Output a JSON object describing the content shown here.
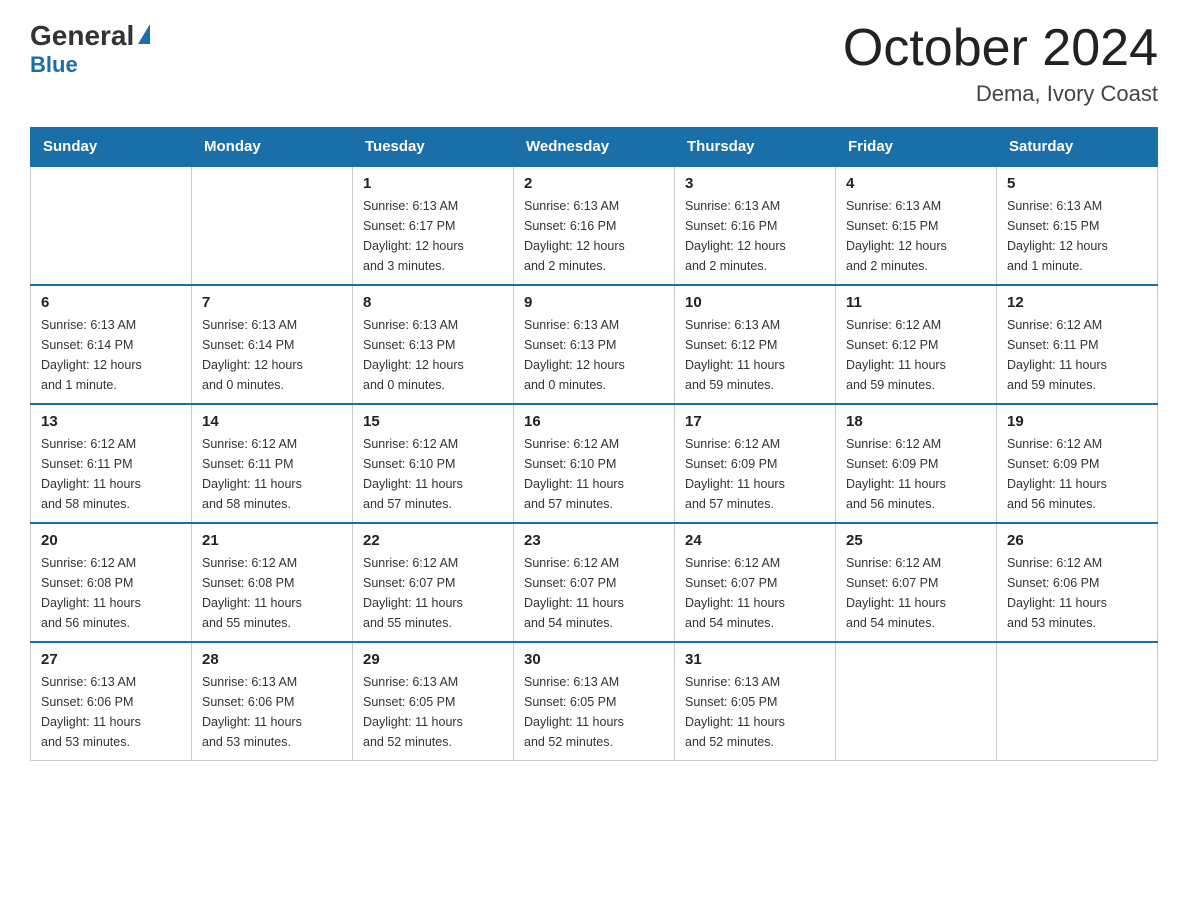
{
  "logo": {
    "general": "General",
    "blue": "Blue"
  },
  "title": "October 2024",
  "location": "Dema, Ivory Coast",
  "days_header": [
    "Sunday",
    "Monday",
    "Tuesday",
    "Wednesday",
    "Thursday",
    "Friday",
    "Saturday"
  ],
  "weeks": [
    [
      {
        "day": "",
        "info": ""
      },
      {
        "day": "",
        "info": ""
      },
      {
        "day": "1",
        "info": "Sunrise: 6:13 AM\nSunset: 6:17 PM\nDaylight: 12 hours\nand 3 minutes."
      },
      {
        "day": "2",
        "info": "Sunrise: 6:13 AM\nSunset: 6:16 PM\nDaylight: 12 hours\nand 2 minutes."
      },
      {
        "day": "3",
        "info": "Sunrise: 6:13 AM\nSunset: 6:16 PM\nDaylight: 12 hours\nand 2 minutes."
      },
      {
        "day": "4",
        "info": "Sunrise: 6:13 AM\nSunset: 6:15 PM\nDaylight: 12 hours\nand 2 minutes."
      },
      {
        "day": "5",
        "info": "Sunrise: 6:13 AM\nSunset: 6:15 PM\nDaylight: 12 hours\nand 1 minute."
      }
    ],
    [
      {
        "day": "6",
        "info": "Sunrise: 6:13 AM\nSunset: 6:14 PM\nDaylight: 12 hours\nand 1 minute."
      },
      {
        "day": "7",
        "info": "Sunrise: 6:13 AM\nSunset: 6:14 PM\nDaylight: 12 hours\nand 0 minutes."
      },
      {
        "day": "8",
        "info": "Sunrise: 6:13 AM\nSunset: 6:13 PM\nDaylight: 12 hours\nand 0 minutes."
      },
      {
        "day": "9",
        "info": "Sunrise: 6:13 AM\nSunset: 6:13 PM\nDaylight: 12 hours\nand 0 minutes."
      },
      {
        "day": "10",
        "info": "Sunrise: 6:13 AM\nSunset: 6:12 PM\nDaylight: 11 hours\nand 59 minutes."
      },
      {
        "day": "11",
        "info": "Sunrise: 6:12 AM\nSunset: 6:12 PM\nDaylight: 11 hours\nand 59 minutes."
      },
      {
        "day": "12",
        "info": "Sunrise: 6:12 AM\nSunset: 6:11 PM\nDaylight: 11 hours\nand 59 minutes."
      }
    ],
    [
      {
        "day": "13",
        "info": "Sunrise: 6:12 AM\nSunset: 6:11 PM\nDaylight: 11 hours\nand 58 minutes."
      },
      {
        "day": "14",
        "info": "Sunrise: 6:12 AM\nSunset: 6:11 PM\nDaylight: 11 hours\nand 58 minutes."
      },
      {
        "day": "15",
        "info": "Sunrise: 6:12 AM\nSunset: 6:10 PM\nDaylight: 11 hours\nand 57 minutes."
      },
      {
        "day": "16",
        "info": "Sunrise: 6:12 AM\nSunset: 6:10 PM\nDaylight: 11 hours\nand 57 minutes."
      },
      {
        "day": "17",
        "info": "Sunrise: 6:12 AM\nSunset: 6:09 PM\nDaylight: 11 hours\nand 57 minutes."
      },
      {
        "day": "18",
        "info": "Sunrise: 6:12 AM\nSunset: 6:09 PM\nDaylight: 11 hours\nand 56 minutes."
      },
      {
        "day": "19",
        "info": "Sunrise: 6:12 AM\nSunset: 6:09 PM\nDaylight: 11 hours\nand 56 minutes."
      }
    ],
    [
      {
        "day": "20",
        "info": "Sunrise: 6:12 AM\nSunset: 6:08 PM\nDaylight: 11 hours\nand 56 minutes."
      },
      {
        "day": "21",
        "info": "Sunrise: 6:12 AM\nSunset: 6:08 PM\nDaylight: 11 hours\nand 55 minutes."
      },
      {
        "day": "22",
        "info": "Sunrise: 6:12 AM\nSunset: 6:07 PM\nDaylight: 11 hours\nand 55 minutes."
      },
      {
        "day": "23",
        "info": "Sunrise: 6:12 AM\nSunset: 6:07 PM\nDaylight: 11 hours\nand 54 minutes."
      },
      {
        "day": "24",
        "info": "Sunrise: 6:12 AM\nSunset: 6:07 PM\nDaylight: 11 hours\nand 54 minutes."
      },
      {
        "day": "25",
        "info": "Sunrise: 6:12 AM\nSunset: 6:07 PM\nDaylight: 11 hours\nand 54 minutes."
      },
      {
        "day": "26",
        "info": "Sunrise: 6:12 AM\nSunset: 6:06 PM\nDaylight: 11 hours\nand 53 minutes."
      }
    ],
    [
      {
        "day": "27",
        "info": "Sunrise: 6:13 AM\nSunset: 6:06 PM\nDaylight: 11 hours\nand 53 minutes."
      },
      {
        "day": "28",
        "info": "Sunrise: 6:13 AM\nSunset: 6:06 PM\nDaylight: 11 hours\nand 53 minutes."
      },
      {
        "day": "29",
        "info": "Sunrise: 6:13 AM\nSunset: 6:05 PM\nDaylight: 11 hours\nand 52 minutes."
      },
      {
        "day": "30",
        "info": "Sunrise: 6:13 AM\nSunset: 6:05 PM\nDaylight: 11 hours\nand 52 minutes."
      },
      {
        "day": "31",
        "info": "Sunrise: 6:13 AM\nSunset: 6:05 PM\nDaylight: 11 hours\nand 52 minutes."
      },
      {
        "day": "",
        "info": ""
      },
      {
        "day": "",
        "info": ""
      }
    ]
  ]
}
